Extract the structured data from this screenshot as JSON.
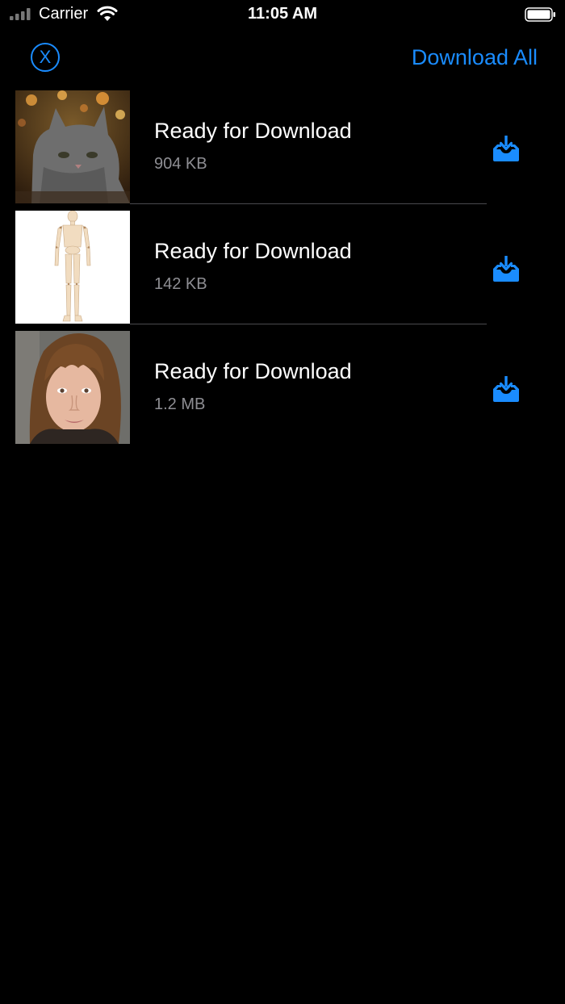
{
  "status_bar": {
    "carrier": "Carrier",
    "time": "11:05 AM"
  },
  "nav": {
    "close_label": "X",
    "download_all_label": "Download All"
  },
  "items": [
    {
      "title": "Ready for Download",
      "size": "904 KB",
      "thumbnail": "cat-photo"
    },
    {
      "title": "Ready for Download",
      "size": "142 KB",
      "thumbnail": "mannequin-photo"
    },
    {
      "title": "Ready for Download",
      "size": "1.2 MB",
      "thumbnail": "portrait-photo"
    }
  ],
  "colors": {
    "accent": "#1a8cff",
    "background": "#000000",
    "secondary_text": "#8e8e93",
    "separator": "#4a4a4e"
  }
}
